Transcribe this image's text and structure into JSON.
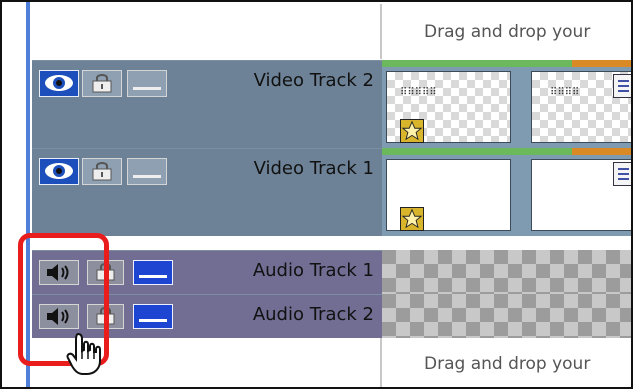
{
  "timeline": {
    "drop_top_text": "Drag and drop your",
    "drop_bottom_text": "Drag and drop your"
  },
  "tracks": [
    {
      "name": "Video Track 2"
    },
    {
      "name": "Video Track 1"
    },
    {
      "name": "Audio Track 1"
    },
    {
      "name": "Audio Track 2"
    }
  ],
  "icons": {
    "visibility": "eye-icon",
    "lock": "lock-icon",
    "mute": "speaker-icon",
    "bar": "bar-icon",
    "clip_marker": "star-icon",
    "clip_menu": "menu-icon",
    "pointer": "hand-pointer-icon"
  },
  "colors": {
    "video_track": "#6d8296",
    "audio_track": "#716d93",
    "highlight": "#ea1d1d",
    "accent_blue": "#1d45d2"
  }
}
